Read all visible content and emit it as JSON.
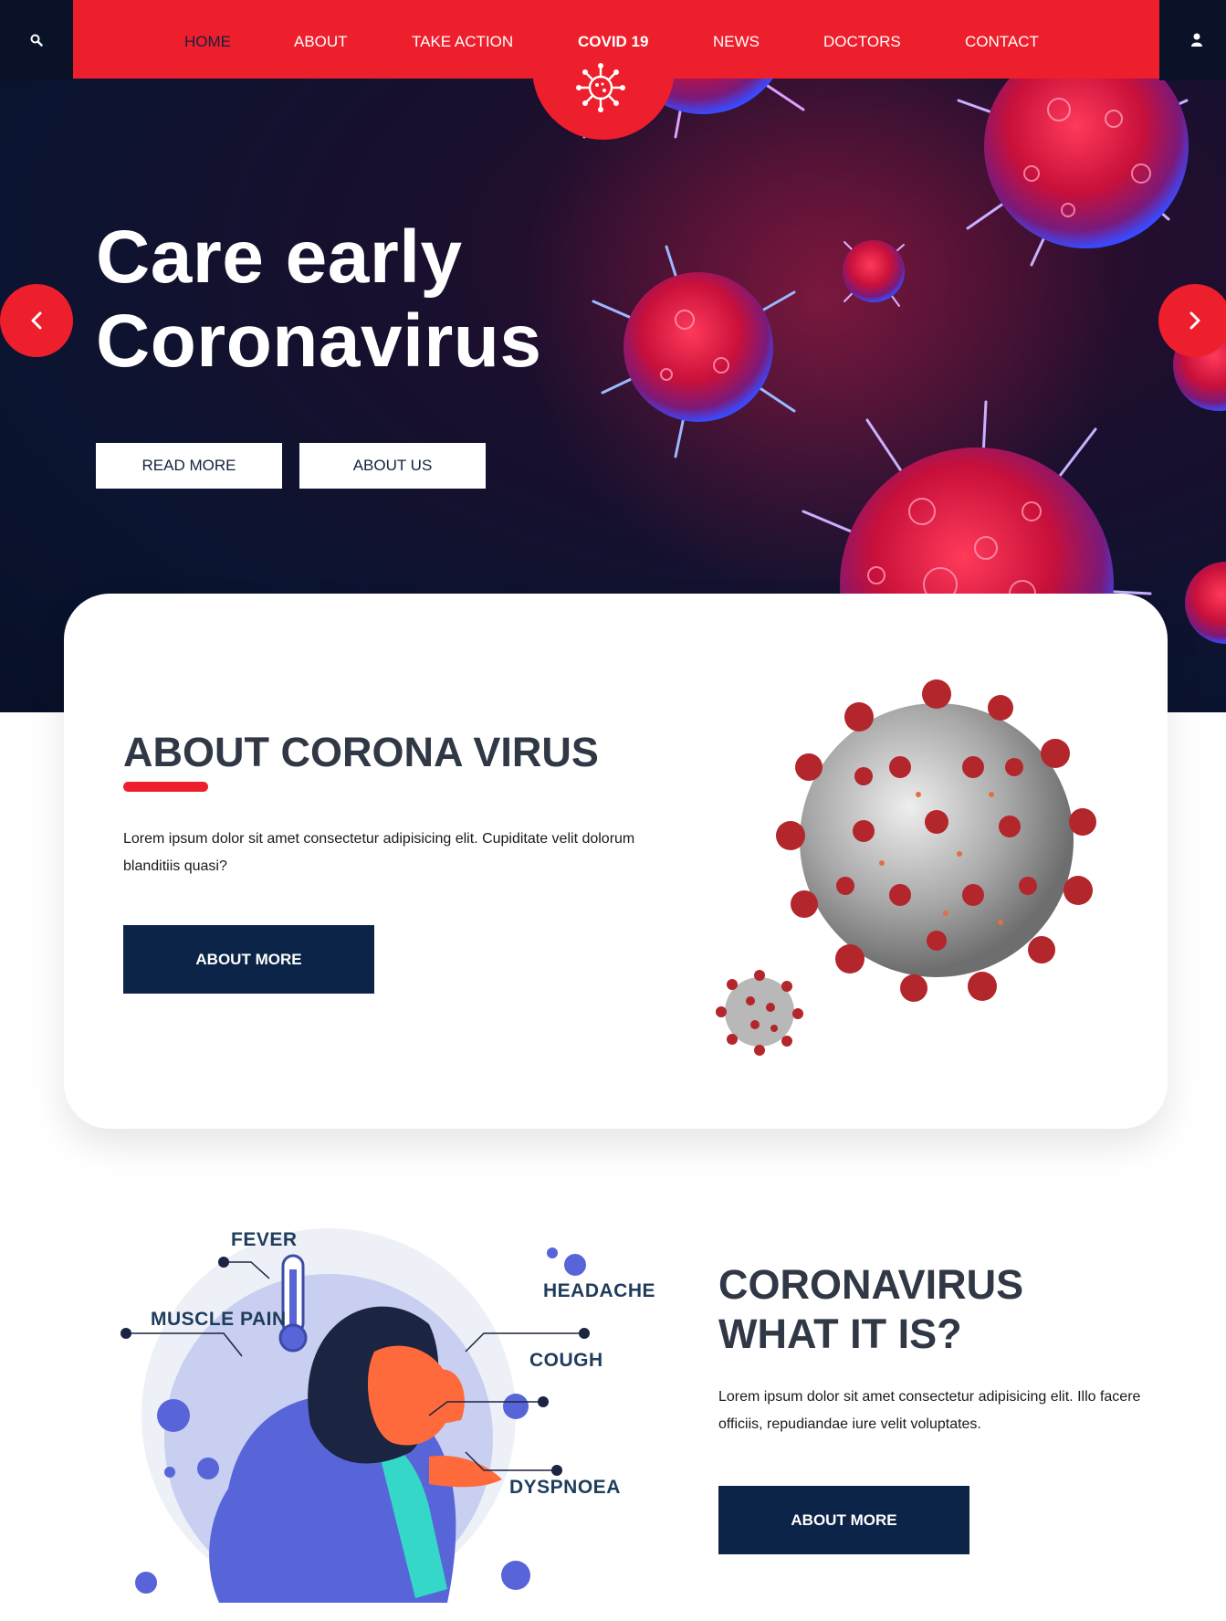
{
  "nav": {
    "items": [
      {
        "label": "HOME"
      },
      {
        "label": "ABOUT"
      },
      {
        "label": "TAKE ACTION"
      },
      {
        "label": "COVID 19"
      },
      {
        "label": "NEWS"
      },
      {
        "label": "DOCTORS"
      },
      {
        "label": "CONTACT"
      }
    ],
    "active": "COVID 19",
    "search_icon": "search-icon",
    "user_icon": "user-icon",
    "logo_icon": "virus-icon"
  },
  "hero": {
    "title_line1": "Care early",
    "title_line2": "Coronavirus",
    "btn_read_more": "READ MORE",
    "btn_about_us": "ABOUT US",
    "prev_icon": "chevron-left-icon",
    "next_icon": "chevron-right-icon"
  },
  "about": {
    "title": "ABOUT CORONA VIRUS",
    "text": "Lorem ipsum dolor sit amet consectetur adipisicing elit. Cupiditate velit dolorum blanditiis quasi?",
    "button": "ABOUT MORE"
  },
  "symptoms": {
    "labels": {
      "fever": "FEVER",
      "muscle_pain": "MUSCLE PAIN",
      "headache": "HEADACHE",
      "cough": "COUGH",
      "dyspnoea": "DYSPNOEA"
    }
  },
  "what": {
    "title_line1": "CORONAVIRUS",
    "title_line2": "WHAT IT IS?",
    "text": "Lorem ipsum dolor sit amet consectetur adipisicing elit. Illo facere officiis, repudiandae iure velit voluptates.",
    "button": "ABOUT MORE"
  },
  "colors": {
    "brand_red": "#ee1f2c",
    "navy": "#0c2448",
    "hero_bg": "#0b1430",
    "heading": "#303846"
  }
}
